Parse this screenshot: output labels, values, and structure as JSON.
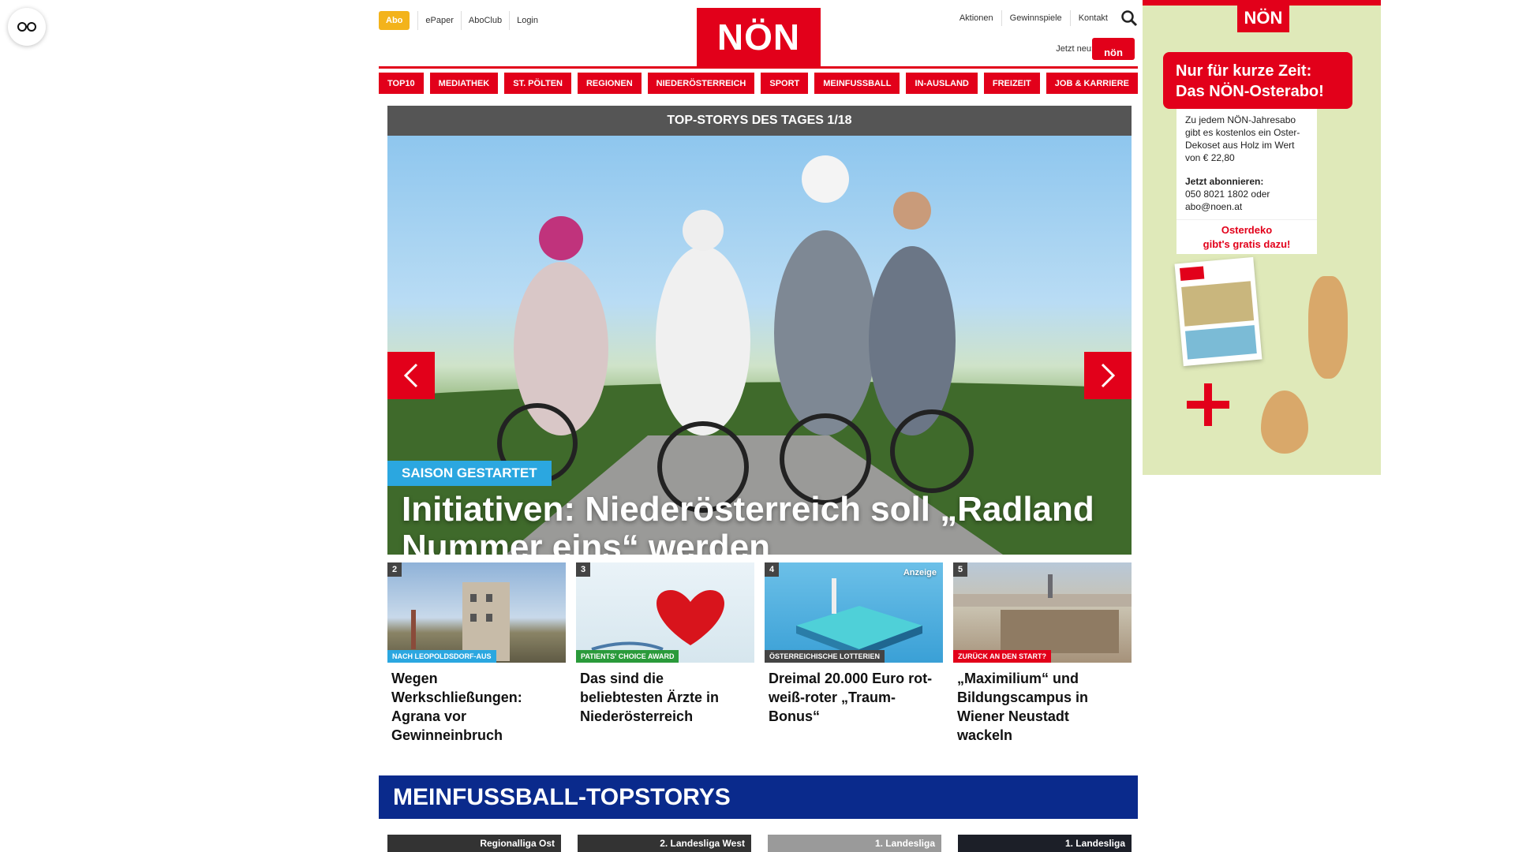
{
  "header": {
    "abo": "Abo",
    "left_links": [
      "ePaper",
      "AboClub",
      "Login"
    ],
    "logo": "NÖN",
    "right_links": [
      "Aktionen",
      "Gewinnspiele",
      "Kontakt"
    ],
    "now_label": "Jetzt neu:",
    "mini_logo": "nön"
  },
  "nav": [
    "TOP10",
    "MEDIATHEK",
    "ST. PÖLTEN",
    "REGIONEN",
    "NIEDERÖSTERREICH",
    "SPORT",
    "MEINFUSSBALL",
    "IN-AUSLAND",
    "FREIZEIT",
    "JOB & KARRIERE"
  ],
  "hero": {
    "bar": "TOP-STORYS DES TAGES 1/18",
    "tag": "SAISON GESTARTET",
    "title": "Initiativen: Niederösterreich soll „Radland Nummer eins“ werden"
  },
  "stories": [
    {
      "num": "2",
      "tag": "NACH LEOPOLDSDORF-AUS",
      "tag_color": "#2ba7e0",
      "title": "Wegen Werkschließungen: Agrana vor Gewinneinbruch",
      "ad": ""
    },
    {
      "num": "3",
      "tag": "PATIENTS' CHOICE AWARD",
      "tag_color": "#2a9a3a",
      "title": "Das sind die beliebtesten Ärzte in Niederösterreich",
      "ad": ""
    },
    {
      "num": "4",
      "tag": "ÖSTERREICHISCHE LOTTERIEN",
      "tag_color": "#444444",
      "title": "Dreimal 20.000 Euro rot-weiß-roter „Traum-Bonus“",
      "ad": "Anzeige"
    },
    {
      "num": "5",
      "tag": "ZURÜCK AN DEN START?",
      "tag_color": "#e2001a",
      "title": "„Maximilium“ und Bildungscampus in Wiener Neustadt wackeln",
      "ad": ""
    }
  ],
  "football": {
    "title": "MEINFUSSBALL-TOPSTORYS",
    "cards": [
      "Regionalliga Ost",
      "2. Landesliga West",
      "1. Landesliga",
      "1. Landesliga"
    ]
  },
  "ad": {
    "logo": "NÖN",
    "headline_1": "Nur für kurze Zeit:",
    "headline_2": "Das NÖN-Osterabo!",
    "body": "Zu jedem NÖN-Jahresabo gibt es kostenlos ein Oster-Dekoset aus Holz im Wert von € 22,80",
    "subscribe_label": "Jetzt abonnieren:",
    "contact": "050 8021 1802 oder abo@noen.at",
    "cta_1": "Osterdeko",
    "cta_2": "gibt's gratis dazu!"
  },
  "colors": {
    "brand_red": "#e2001a",
    "abo_yellow": "#f3b31b",
    "football_blue": "#0a2a8c",
    "tag_blue": "#2ba7e0"
  }
}
